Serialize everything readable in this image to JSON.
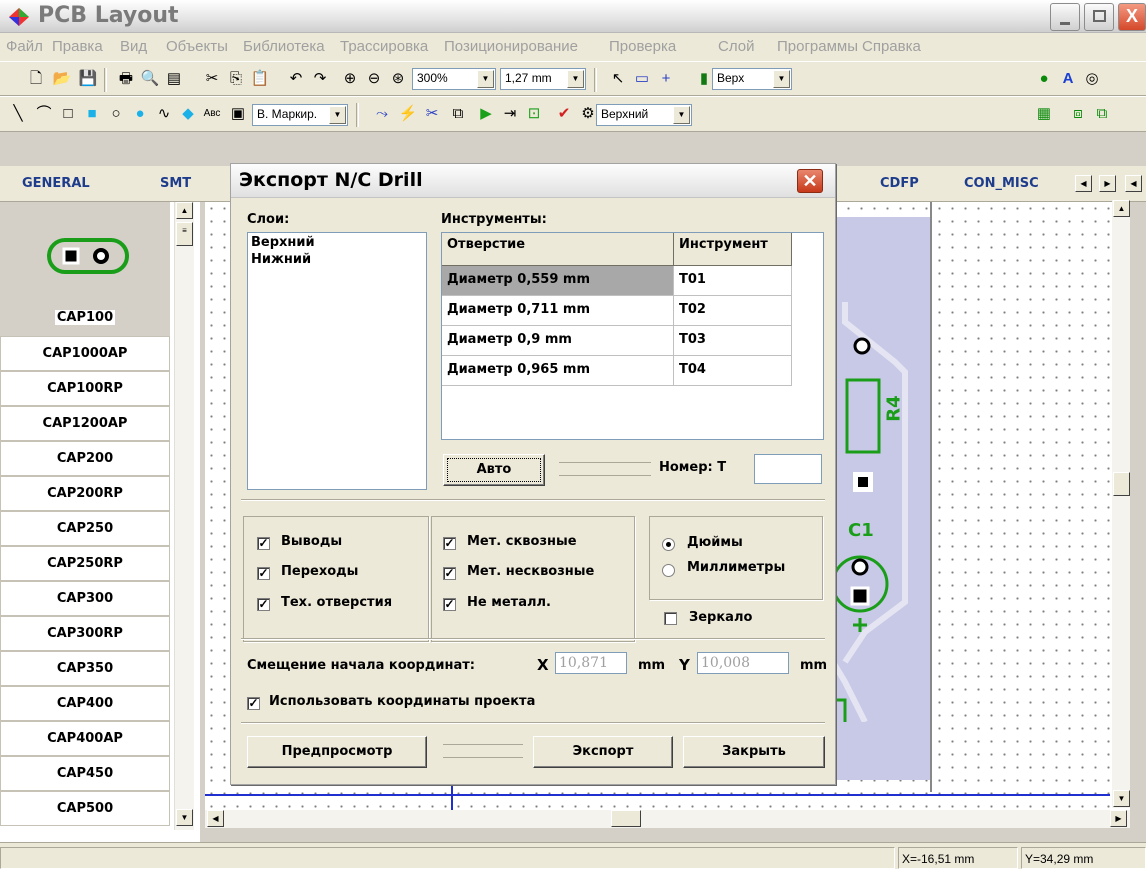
{
  "app": {
    "title": "PCB Layout"
  },
  "menu": [
    "Файл",
    "Правка",
    "Вид",
    "Объекты",
    "Библиотека",
    "Трассировка",
    "Позиционирование",
    "Проверка",
    "Слой",
    "Программы",
    "Справка"
  ],
  "toolbar1": {
    "zoom": "300%",
    "grid": "1,27 mm",
    "layer_side": "Верх"
  },
  "toolbar2": {
    "mark_style": "В. Маркир.",
    "text_icon": "Авс",
    "layer": "Верхний"
  },
  "lib_tabs": [
    "GENERAL",
    "SMT",
    "CDFP",
    "CON_MISC"
  ],
  "components": [
    "CAP100",
    "CAP1000AP",
    "CAP100RP",
    "CAP1200AP",
    "CAP200",
    "CAP200RP",
    "CAP250",
    "CAP250RP",
    "CAP300",
    "CAP300RP",
    "CAP350",
    "CAP400",
    "CAP400AP",
    "CAP450",
    "CAP500"
  ],
  "selected_component": "CAP100",
  "board": {
    "ref_r4": "R4",
    "ref_c1": "C1"
  },
  "status": {
    "x": "X=-16,51 mm",
    "y": "Y=34,29 mm"
  },
  "dialog": {
    "title": "Экспорт N/C Drill",
    "layers_label": "Слои:",
    "layers": [
      "Верхний",
      "Нижний"
    ],
    "tools_label": "Инструменты:",
    "tools_headers": {
      "hole": "Отверстие",
      "tool": "Инструмент"
    },
    "tools": [
      {
        "hole": "Диаметр 0,559 mm",
        "tool": "T01"
      },
      {
        "hole": "Диаметр 0,711 mm",
        "tool": "T02"
      },
      {
        "hole": "Диаметр 0,9 mm",
        "tool": "T03"
      },
      {
        "hole": "Диаметр 0,965 mm",
        "tool": "T04"
      }
    ],
    "auto_button": "Авто",
    "number_label": "Номер: T",
    "number_value": "",
    "checks_a": [
      {
        "label": "Выводы",
        "checked": true
      },
      {
        "label": "Переходы",
        "checked": true
      },
      {
        "label": "Тех. отверстия",
        "checked": true
      }
    ],
    "checks_b": [
      {
        "label": "Мет. сквозные",
        "checked": true
      },
      {
        "label": "Мет. несквозные",
        "checked": true
      },
      {
        "label": "Не металл.",
        "checked": true
      }
    ],
    "units": {
      "inches": "Дюймы",
      "mm": "Миллиметры",
      "selected": "inches"
    },
    "mirror": {
      "label": "Зеркало",
      "checked": false
    },
    "offset": {
      "label": "Смещение начала координат:",
      "x_label": "X",
      "x_value": "10,871",
      "x_unit": "mm",
      "y_label": "Y",
      "y_value": "10,008",
      "y_unit": "mm"
    },
    "use_project": {
      "label": "Использовать координаты проекта",
      "checked": true
    },
    "preview_button": "Предпросмотр",
    "export_button": "Экспорт",
    "close_button": "Закрыть"
  }
}
